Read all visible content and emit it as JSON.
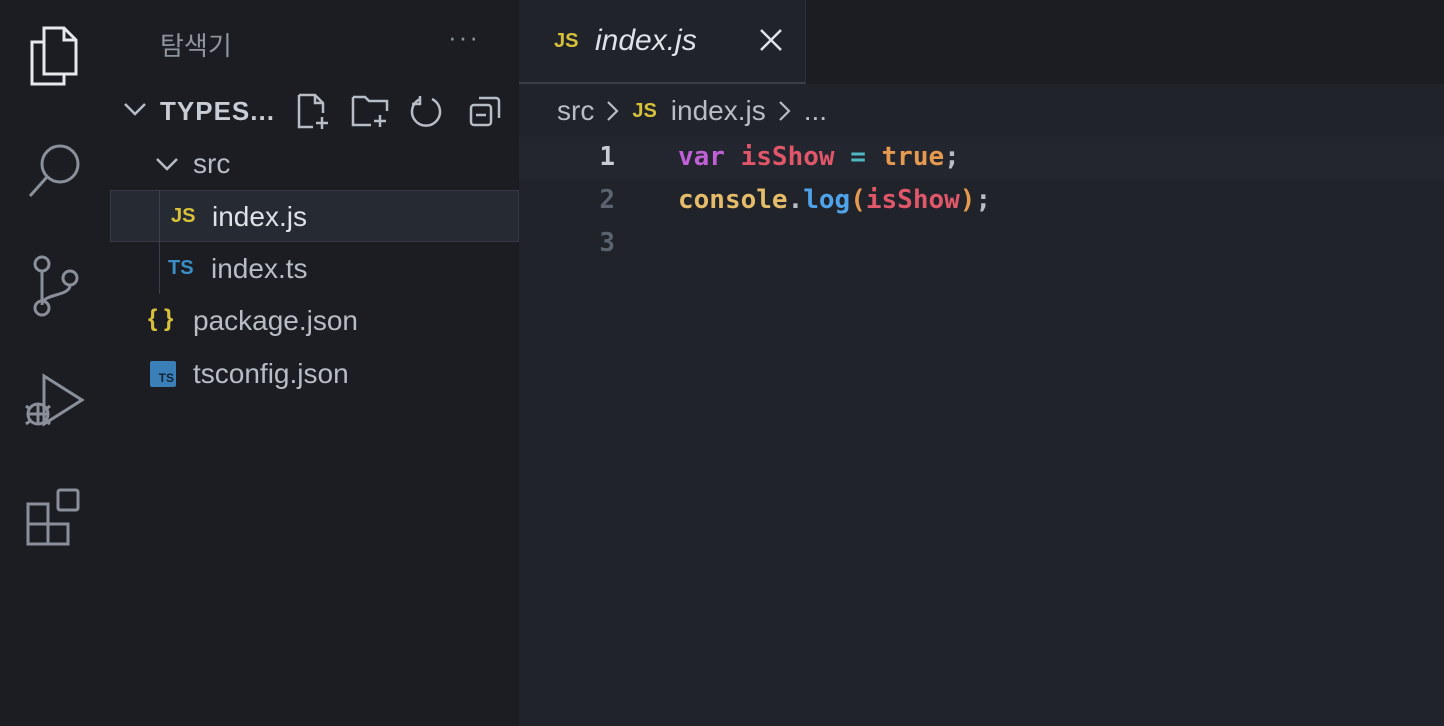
{
  "sidebar": {
    "title": "탐색기",
    "more": "···",
    "project": "TYPES...",
    "tree": [
      {
        "name": "src",
        "kind": "folder"
      },
      {
        "name": "index.js",
        "kind": "js",
        "icon": "JS"
      },
      {
        "name": "index.ts",
        "kind": "ts",
        "icon": "TS"
      },
      {
        "name": "package.json",
        "kind": "json",
        "icon": "{ }"
      },
      {
        "name": "tsconfig.json",
        "kind": "tsconfig",
        "icon": "TS"
      }
    ]
  },
  "tab": {
    "icon": "JS",
    "label": "index.js"
  },
  "breadcrumb": {
    "folder": "src",
    "icon": "JS",
    "file": "index.js",
    "more": "..."
  },
  "code": {
    "line_numbers": [
      "1",
      "2",
      "3"
    ],
    "line1": {
      "kw": "var",
      "name": "isShow",
      "op": "=",
      "val": "true",
      "end": ";"
    },
    "line2": {
      "obj": "console",
      "dot": ".",
      "fn": "log",
      "open": "(",
      "arg": "isShow",
      "close": ")",
      "end": ";"
    }
  }
}
